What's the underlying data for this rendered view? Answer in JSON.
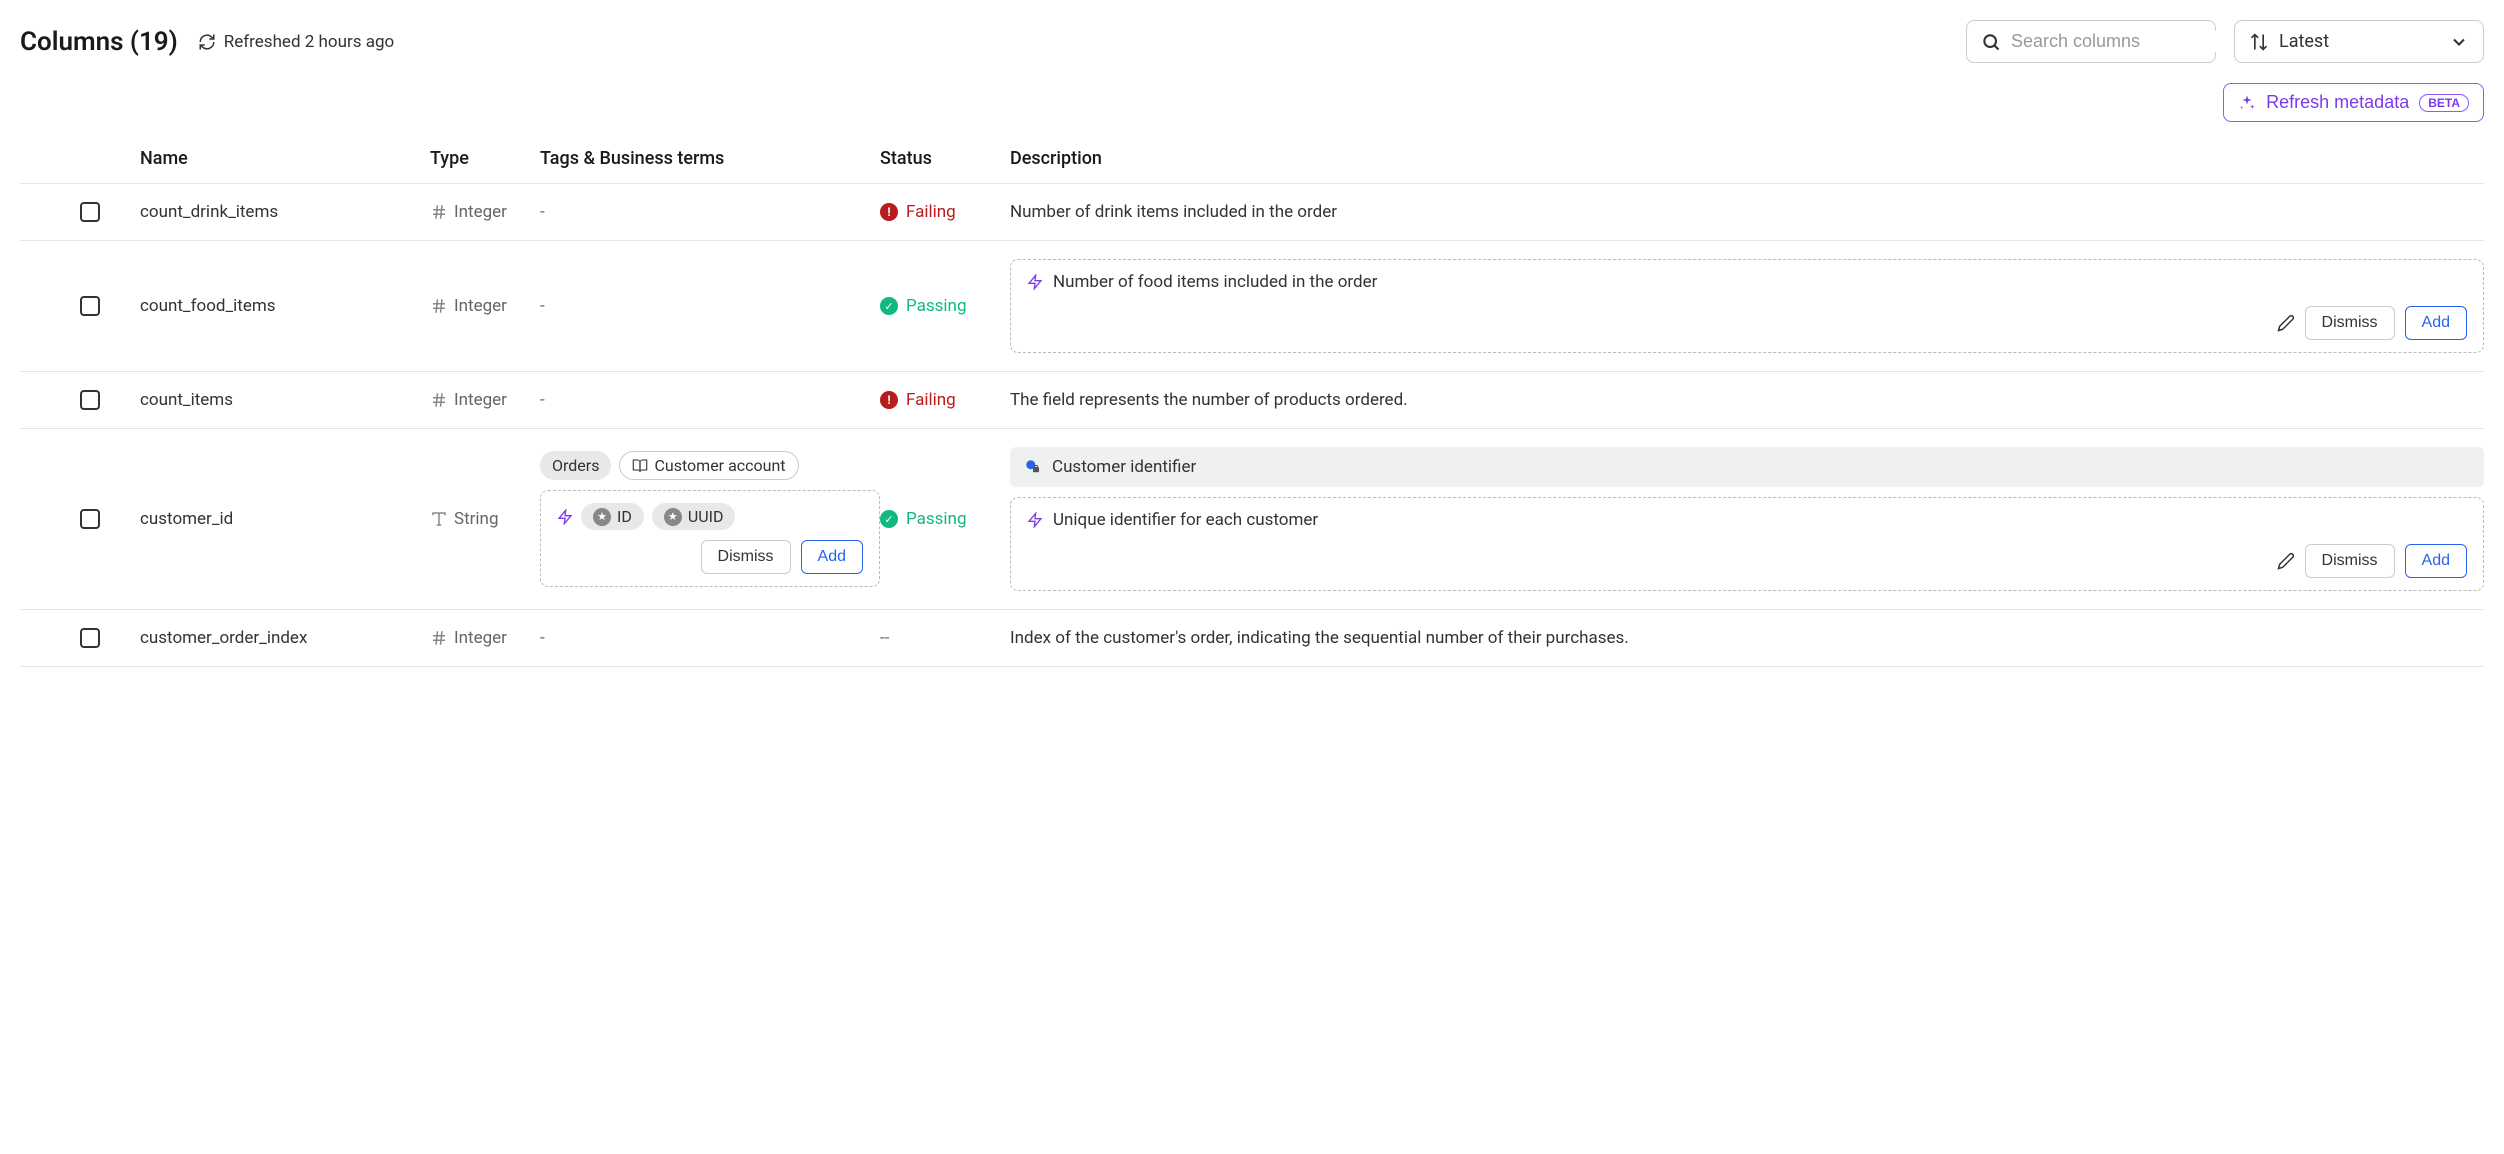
{
  "header": {
    "title": "Columns (19)",
    "refreshed": "Refreshed 2 hours ago",
    "search_placeholder": "Search columns",
    "sort_label": "Latest",
    "refresh_metadata_label": "Refresh metadata",
    "beta_label": "BETA"
  },
  "columns_header": {
    "name": "Name",
    "type": "Type",
    "tags": "Tags & Business terms",
    "status": "Status",
    "description": "Description"
  },
  "status_labels": {
    "failing": "Failing",
    "passing": "Passing",
    "none": "--"
  },
  "buttons": {
    "dismiss": "Dismiss",
    "add": "Add"
  },
  "rows": [
    {
      "name": "count_drink_items",
      "type": "Integer",
      "type_icon": "hash",
      "tags_display": "-",
      "status": "failing",
      "description": "Number of drink items included in the order"
    },
    {
      "name": "count_food_items",
      "type": "Integer",
      "type_icon": "hash",
      "tags_display": "-",
      "status": "passing",
      "suggestion": {
        "text": "Number of food items included in the order"
      }
    },
    {
      "name": "count_items",
      "type": "Integer",
      "type_icon": "hash",
      "tags_display": "-",
      "status": "failing",
      "description": "The field represents the number of products ordered."
    },
    {
      "name": "customer_id",
      "type": "String",
      "type_icon": "text",
      "tags": {
        "existing": [
          {
            "label": "Orders",
            "style": "gray"
          },
          {
            "label": "Customer account",
            "style": "outline",
            "icon": "book"
          }
        ],
        "suggested": [
          {
            "label": "ID"
          },
          {
            "label": "UUID"
          }
        ]
      },
      "status": "passing",
      "info_strip": "Customer identifier",
      "suggestion": {
        "text": "Unique identifier for each customer"
      }
    },
    {
      "name": "customer_order_index",
      "type": "Integer",
      "type_icon": "hash",
      "tags_display": "-",
      "status": "none",
      "description": "Index of the customer's order, indicating the sequential number of their purchases."
    }
  ]
}
